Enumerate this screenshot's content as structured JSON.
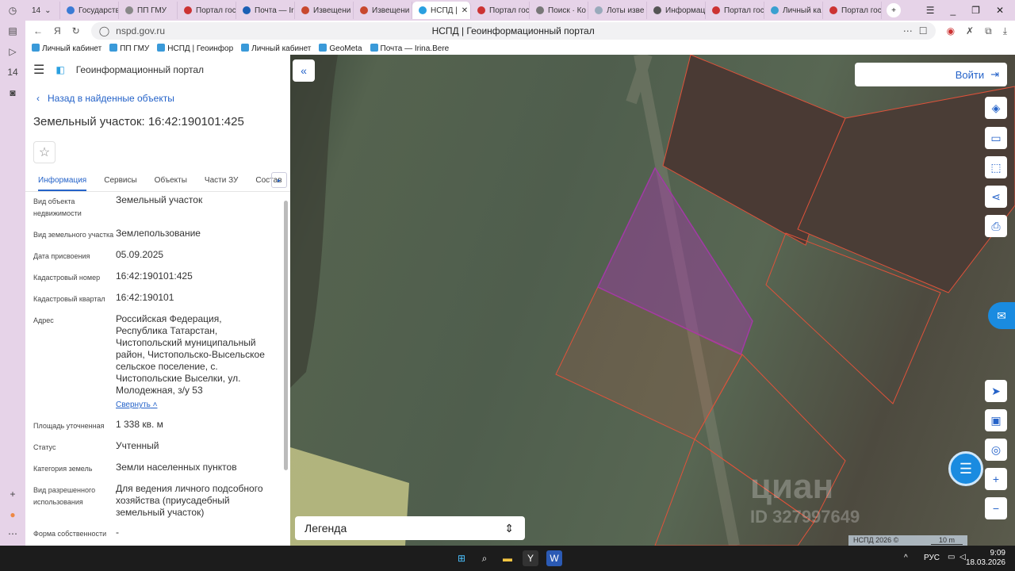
{
  "browser": {
    "tab_count": "14",
    "tabs": [
      "Государстве",
      "ПП ГМУ",
      "Портал гос",
      "Почта — Iri",
      "Извещени",
      "Извещени",
      "НСПД |",
      "Портал гос",
      "Поиск · Ко",
      "Лоты изве",
      "Информац",
      "Портал гос",
      "Личный ка",
      "Портал гос"
    ],
    "active_tab": 6,
    "url": "nspd.gov.ru",
    "page_title": "НСПД | Геоинформационный портал",
    "bookmarks": [
      "Личный кабинет",
      "ПП ГМУ",
      "НСПД | Геоинфор",
      "Личный кабинет",
      "GeoMeta",
      "Почта — Irina.Bere"
    ]
  },
  "panel": {
    "portal_name": "Геоинформационный портал",
    "back_link": "Назад в найденные объекты",
    "title": "Земельный участок: 16:42:190101:425",
    "tabs": [
      "Информация",
      "Сервисы",
      "Объекты",
      "Части ЗУ",
      "Состав"
    ],
    "rows": [
      {
        "k": "Вид объекта недвижимости",
        "v": "Земельный участок"
      },
      {
        "k": "Вид земельного участка",
        "v": "Землепользование"
      },
      {
        "k": "Дата присвоения",
        "v": "05.09.2025"
      },
      {
        "k": "Кадастровый номер",
        "v": "16:42:190101:425"
      },
      {
        "k": "Кадастровый квартал",
        "v": "16:42:190101"
      },
      {
        "k": "Адрес",
        "v": "Российская Федерация, Республика Татарстан, Чистопольский муниципальный район, Чистопольско-Высельское сельское поселение, с. Чистопольские Выселки, ул. Молодежная, з/у 53"
      },
      {
        "k": "Площадь уточненная",
        "v": "1 338 кв. м"
      },
      {
        "k": "Статус",
        "v": "Учтенный"
      },
      {
        "k": "Категория земель",
        "v": "Земли населенных пунктов"
      },
      {
        "k": "Вид разрешенного использования",
        "v": "Для ведения личного подсобного хозяйства (приусадебный земельный участок)"
      },
      {
        "k": "Форма собственности",
        "v": "-"
      }
    ],
    "collapse_link": "Свернуть"
  },
  "map": {
    "login": "Войти",
    "legend": "Легенда",
    "copyright": "НСПД 2026 ©",
    "scale": "10 m",
    "watermark": "циан",
    "watermark_id": "ID 327997649",
    "selected_color": "#a23aa6",
    "parcel_color": "#e0523a"
  },
  "taskbar": {
    "lang": "РУС",
    "time": "9:09",
    "date": "18.03.2026"
  }
}
